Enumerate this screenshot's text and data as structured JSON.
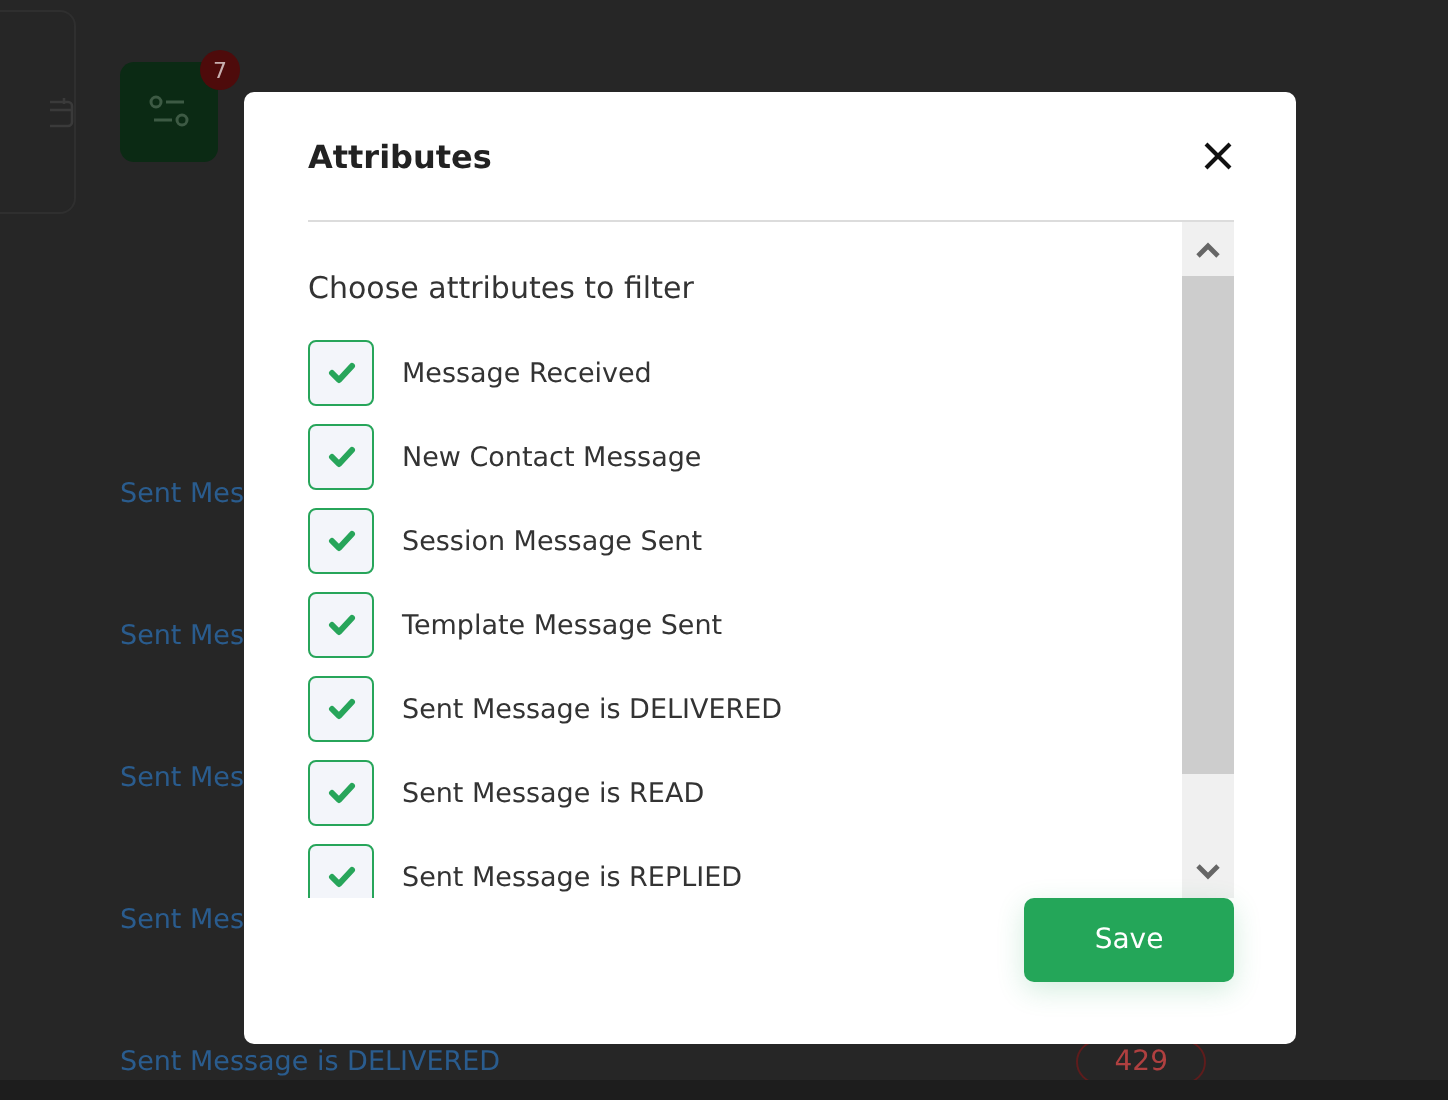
{
  "background": {
    "filter_badge": "7",
    "links": [
      "Sent Mes",
      "Sent Mes",
      "Sent Mes",
      "Sent Mes",
      "Sent Message is DELIVERED"
    ],
    "count": "429"
  },
  "modal": {
    "title": "Attributes",
    "prompt": "Choose attributes to filter",
    "attributes": [
      {
        "label": "Message Received",
        "checked": true
      },
      {
        "label": "New Contact Message",
        "checked": true
      },
      {
        "label": "Session Message Sent",
        "checked": true
      },
      {
        "label": "Template Message Sent",
        "checked": true
      },
      {
        "label": "Sent Message is DELIVERED",
        "checked": true
      },
      {
        "label": "Sent Message is READ",
        "checked": true
      },
      {
        "label": "Sent Message is REPLIED",
        "checked": true
      }
    ],
    "save": "Save"
  }
}
